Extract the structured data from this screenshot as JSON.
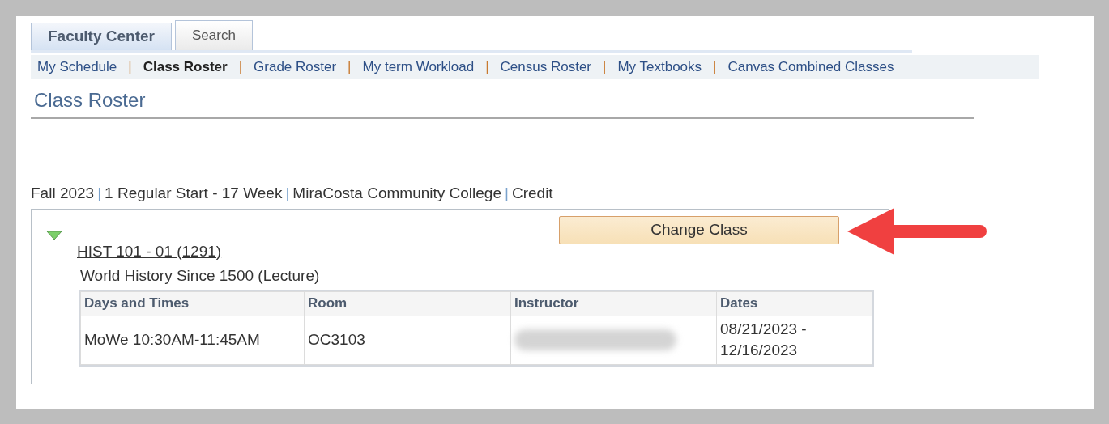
{
  "tabs": [
    {
      "label": "Faculty Center",
      "selected": true
    },
    {
      "label": "Search",
      "selected": false
    }
  ],
  "subnav": [
    {
      "label": "My Schedule",
      "selected": false
    },
    {
      "label": "Class Roster",
      "selected": true
    },
    {
      "label": "Grade Roster",
      "selected": false
    },
    {
      "label": "My term Workload",
      "selected": false
    },
    {
      "label": "Census Roster",
      "selected": false
    },
    {
      "label": "My Textbooks",
      "selected": false
    },
    {
      "label": "Canvas Combined Classes",
      "selected": false
    }
  ],
  "separator": "|",
  "page_title": "Class Roster",
  "term_parts": [
    "Fall 2023",
    "1 Regular Start - 17 Week",
    "MiraCosta Community College",
    "Credit"
  ],
  "section": {
    "expanded": true,
    "course_link": "HIST 101 - 01 (1291)",
    "course_title": "World History Since 1500 (Lecture)",
    "button": "Change Class",
    "table": {
      "columns": [
        "Days and Times",
        "Room",
        "Instructor",
        "Dates"
      ],
      "rows": [
        [
          {
            "kind": "text",
            "text": "MoWe 10:30AM-11:45AM"
          },
          {
            "kind": "text",
            "text": "OC3103"
          },
          {
            "kind": "redacted"
          },
          {
            "kind": "text",
            "text": "08/21/2023 - 12/16/2023"
          }
        ]
      ]
    }
  }
}
